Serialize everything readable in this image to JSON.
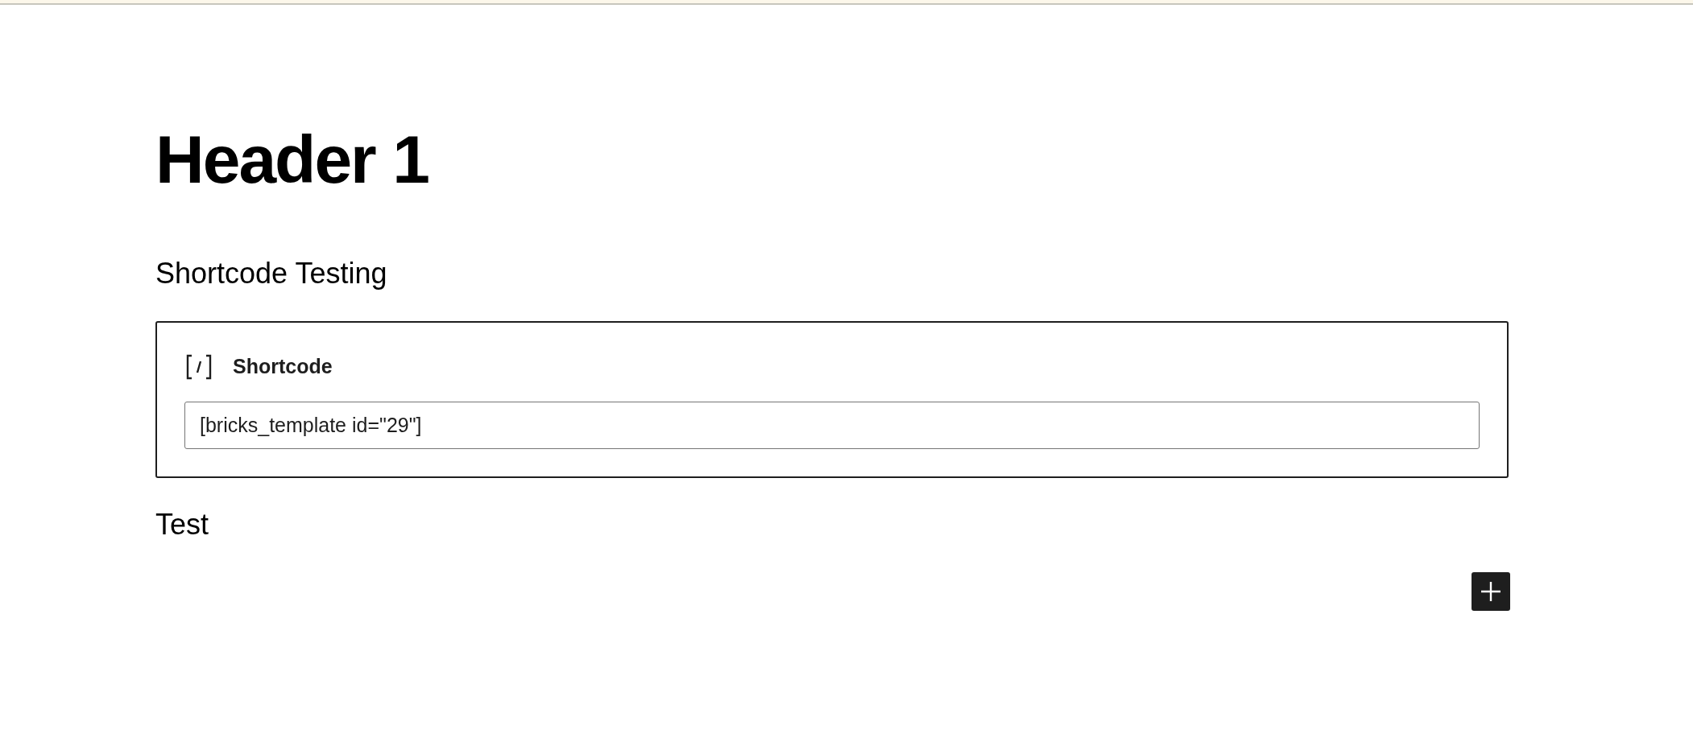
{
  "heading": "Header 1",
  "paragraphs": [
    {
      "text": "Shortcode Testing"
    }
  ],
  "shortcode_block": {
    "label": "Shortcode",
    "value": "[bricks_template id=\"29\"]"
  },
  "after_paragraphs": [
    {
      "text": "Test"
    }
  ]
}
